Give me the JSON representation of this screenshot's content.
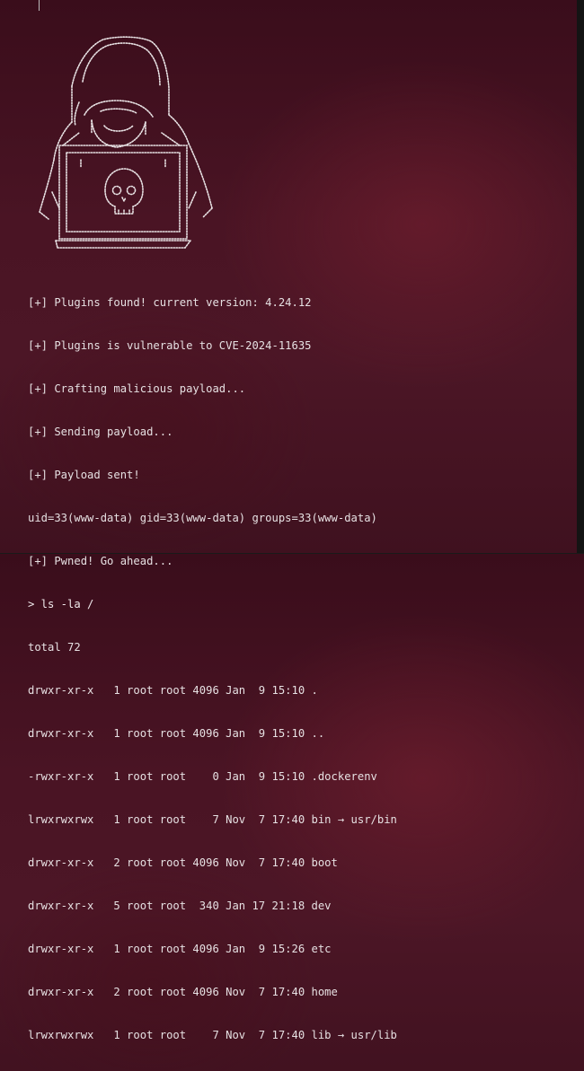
{
  "terminal": {
    "logo_name": "hooded-hacker-skull-ascii-art",
    "text_color": "#e6e0e2",
    "background_color": "#4a1424",
    "lines": [
      "[+] Plugins found! current version: 4.24.12",
      "[+] Plugins is vulnerable to CVE-2024-11635",
      "[+] Crafting malicious payload...",
      "[+] Sending payload...",
      "[+] Payload sent!",
      "uid=33(www-data) gid=33(www-data) groups=33(www-data)",
      "[+] Pwned! Go ahead...",
      "> ls -la /",
      "total 72",
      "drwxr-xr-x   1 root root 4096 Jan  9 15:10 .",
      "drwxr-xr-x   1 root root 4096 Jan  9 15:10 ..",
      "-rwxr-xr-x   1 root root    0 Jan  9 15:10 .dockerenv",
      "lrwxrwxrwx   1 root root    7 Nov  7 17:40 bin → usr/bin",
      "drwxr-xr-x   2 root root 4096 Nov  7 17:40 boot",
      "drwxr-xr-x   5 root root  340 Jan 17 21:18 dev",
      "drwxr-xr-x   1 root root 4096 Jan  9 15:26 etc",
      "drwxr-xr-x   2 root root 4096 Nov  7 17:40 home",
      "lrwxrwxrwx   1 root root    7 Nov  7 17:40 lib → usr/lib"
    ]
  }
}
